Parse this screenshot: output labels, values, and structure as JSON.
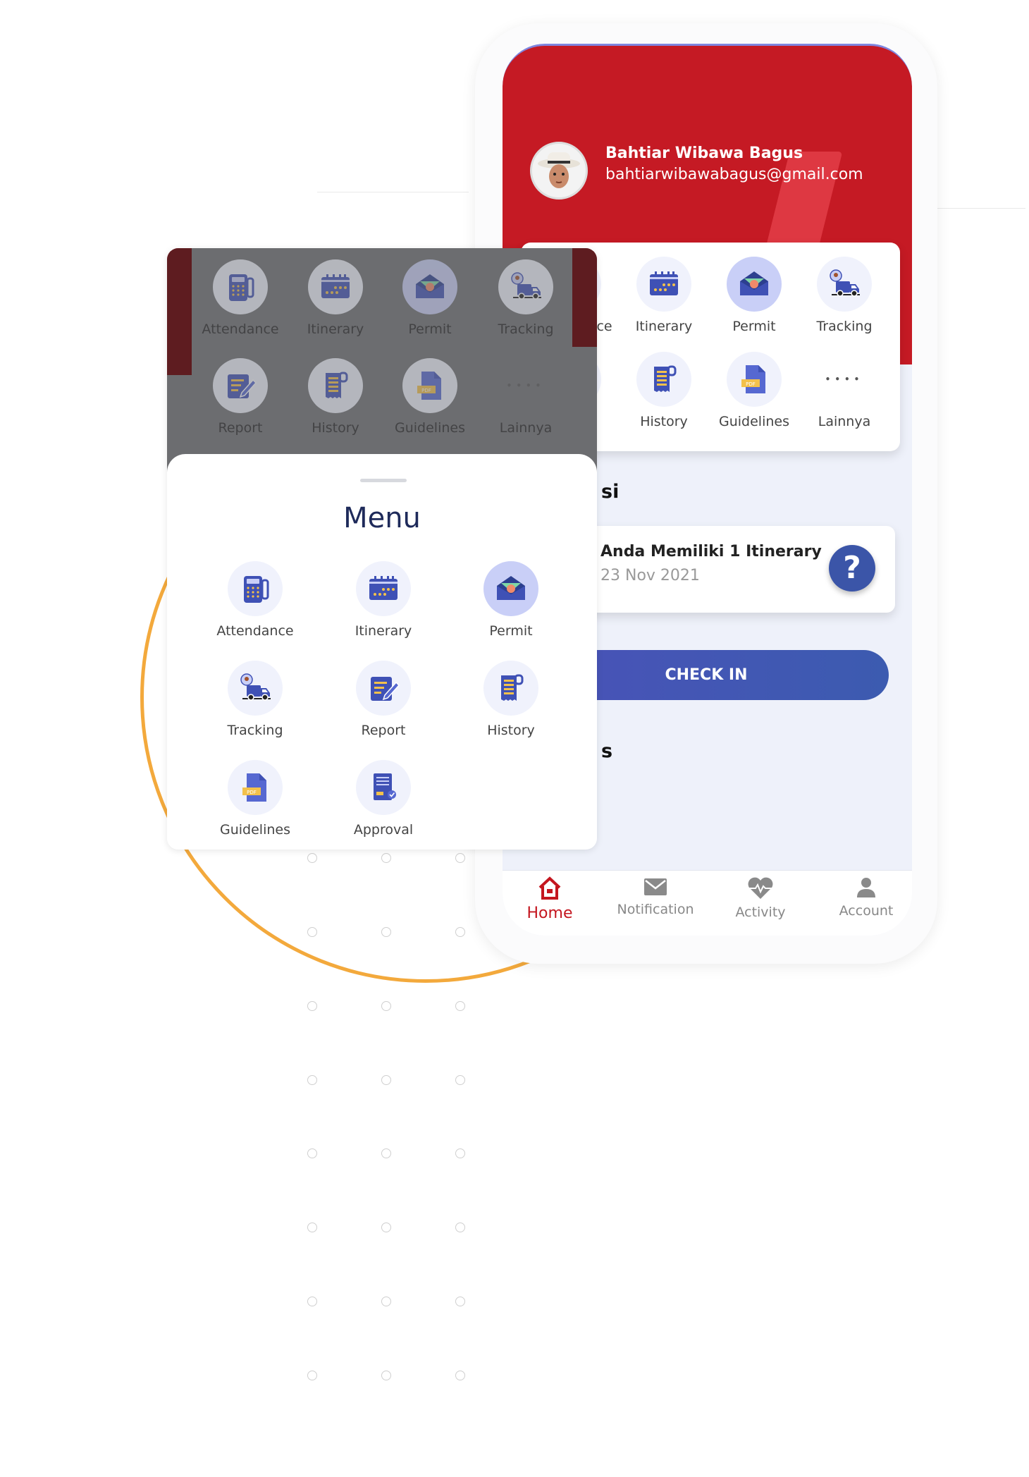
{
  "profile": {
    "name": "Bahtiar Wibawa Bagus",
    "email": "bahtiarwibawabagus@gmail.com"
  },
  "quick_menu": [
    {
      "label": "Attendance",
      "icon": "attendance"
    },
    {
      "label": "Itinerary",
      "icon": "itinerary"
    },
    {
      "label": "Permit",
      "icon": "permit",
      "selected": true
    },
    {
      "label": "Tracking",
      "icon": "tracking"
    },
    {
      "label": "Report",
      "icon": "report"
    },
    {
      "label": "History",
      "icon": "history"
    },
    {
      "label": "Guidelines",
      "icon": "guidelines"
    },
    {
      "label": "Lainnya",
      "icon": "more"
    }
  ],
  "section_fragments": {
    "first": "si",
    "second": "s"
  },
  "itinerary_card": {
    "title": "Anda Memiliki 1 Itinerary",
    "date": "23 Nov 2021",
    "help_icon": "question-icon"
  },
  "checkin": {
    "label": "CHECK IN"
  },
  "bottom_nav": [
    {
      "label": "Home",
      "icon": "home",
      "active": true
    },
    {
      "label": "Notification",
      "icon": "mail"
    },
    {
      "label": "Activity",
      "icon": "heartbeat"
    },
    {
      "label": "Account",
      "icon": "user"
    }
  ],
  "menu_sheet": {
    "title": "Menu",
    "items": [
      {
        "label": "Attendance",
        "icon": "attendance"
      },
      {
        "label": "Itinerary",
        "icon": "itinerary"
      },
      {
        "label": "Permit",
        "icon": "permit",
        "selected": true
      },
      {
        "label": "Tracking",
        "icon": "tracking"
      },
      {
        "label": "Report",
        "icon": "report"
      },
      {
        "label": "History",
        "icon": "history"
      },
      {
        "label": "Guidelines",
        "icon": "guidelines"
      },
      {
        "label": "Approval",
        "icon": "approval"
      }
    ]
  },
  "colors": {
    "brand_red": "#c51a24",
    "primary_blue": "#3f51b5",
    "accent_orange": "#f3a93c"
  }
}
